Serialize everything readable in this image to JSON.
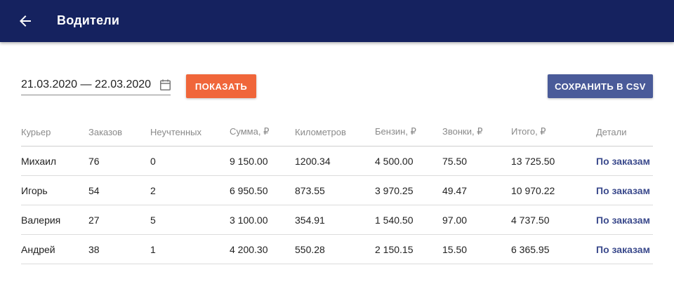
{
  "header": {
    "title": "Водители",
    "back_icon": "arrow-left-icon",
    "background": "#15225f"
  },
  "filters": {
    "date_range": "21.03.2020 — 22.03.2020",
    "calendar_icon": "calendar-icon",
    "show_label": "Показать",
    "show_color": "#f0663a",
    "export_label": "Сохранить в CSV",
    "export_color": "#4a5b99"
  },
  "table": {
    "columns": [
      "Курьер",
      "Заказов",
      "Неучтенных",
      "Сумма, ₽",
      "Километров",
      "Бензин, ₽",
      "Звонки, ₽",
      "Итого, ₽",
      "Детали"
    ],
    "rows": [
      [
        "Михаил",
        "76",
        "0",
        "9 150.00",
        "1200.34",
        "4 500.00",
        "75.50",
        "13 725.50",
        "По заказам"
      ],
      [
        "Игорь",
        "54",
        "2",
        "6 950.50",
        "873.55",
        "3 970.25",
        "49.47",
        "10 970.22",
        "По заказам"
      ],
      [
        "Валерия",
        "27",
        "5",
        "3 100.00",
        "354.91",
        "1 540.50",
        "97.00",
        "4 737.50",
        "По заказам"
      ],
      [
        "Андрей",
        "38",
        "1",
        "4 200.30",
        "550.28",
        "2 150.15",
        "15.50",
        "6 365.95",
        "По заказам"
      ]
    ]
  }
}
